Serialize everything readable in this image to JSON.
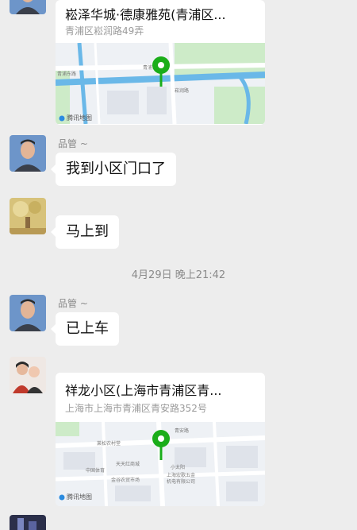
{
  "messages": {
    "loc1": {
      "title": "崧泽华城·德康雅苑(青浦区...",
      "address": "青浦区崧润路49弄",
      "map_road_1": "青浦东路",
      "map_road_2": "青浦东路",
      "map_road_3": "崧润路",
      "map_provider": "腾讯地图"
    },
    "msg1": {
      "sender": "品管 ~",
      "text": "我到小区门口了"
    },
    "msg2": {
      "text": "马上到"
    },
    "timestamp": "4月29日 晚上21:42",
    "msg3": {
      "sender": "品管 ~",
      "text": "已上车"
    },
    "loc2": {
      "title": "祥龙小区(上海市青浦区青...",
      "address": "上海市上海市青浦区青安路352号",
      "map_labels": [
        "莱松农村堂",
        "青安路",
        "中国体育",
        "天天红商城",
        "小太阳",
        "上海宏歌五金",
        "机电有限公司",
        "金谷农贸市场"
      ],
      "map_provider": "腾讯地图"
    }
  },
  "colors": {
    "pin": "#1aad19",
    "background": "#ededed",
    "bubble": "#ffffff",
    "water": "#6ab8e8"
  }
}
